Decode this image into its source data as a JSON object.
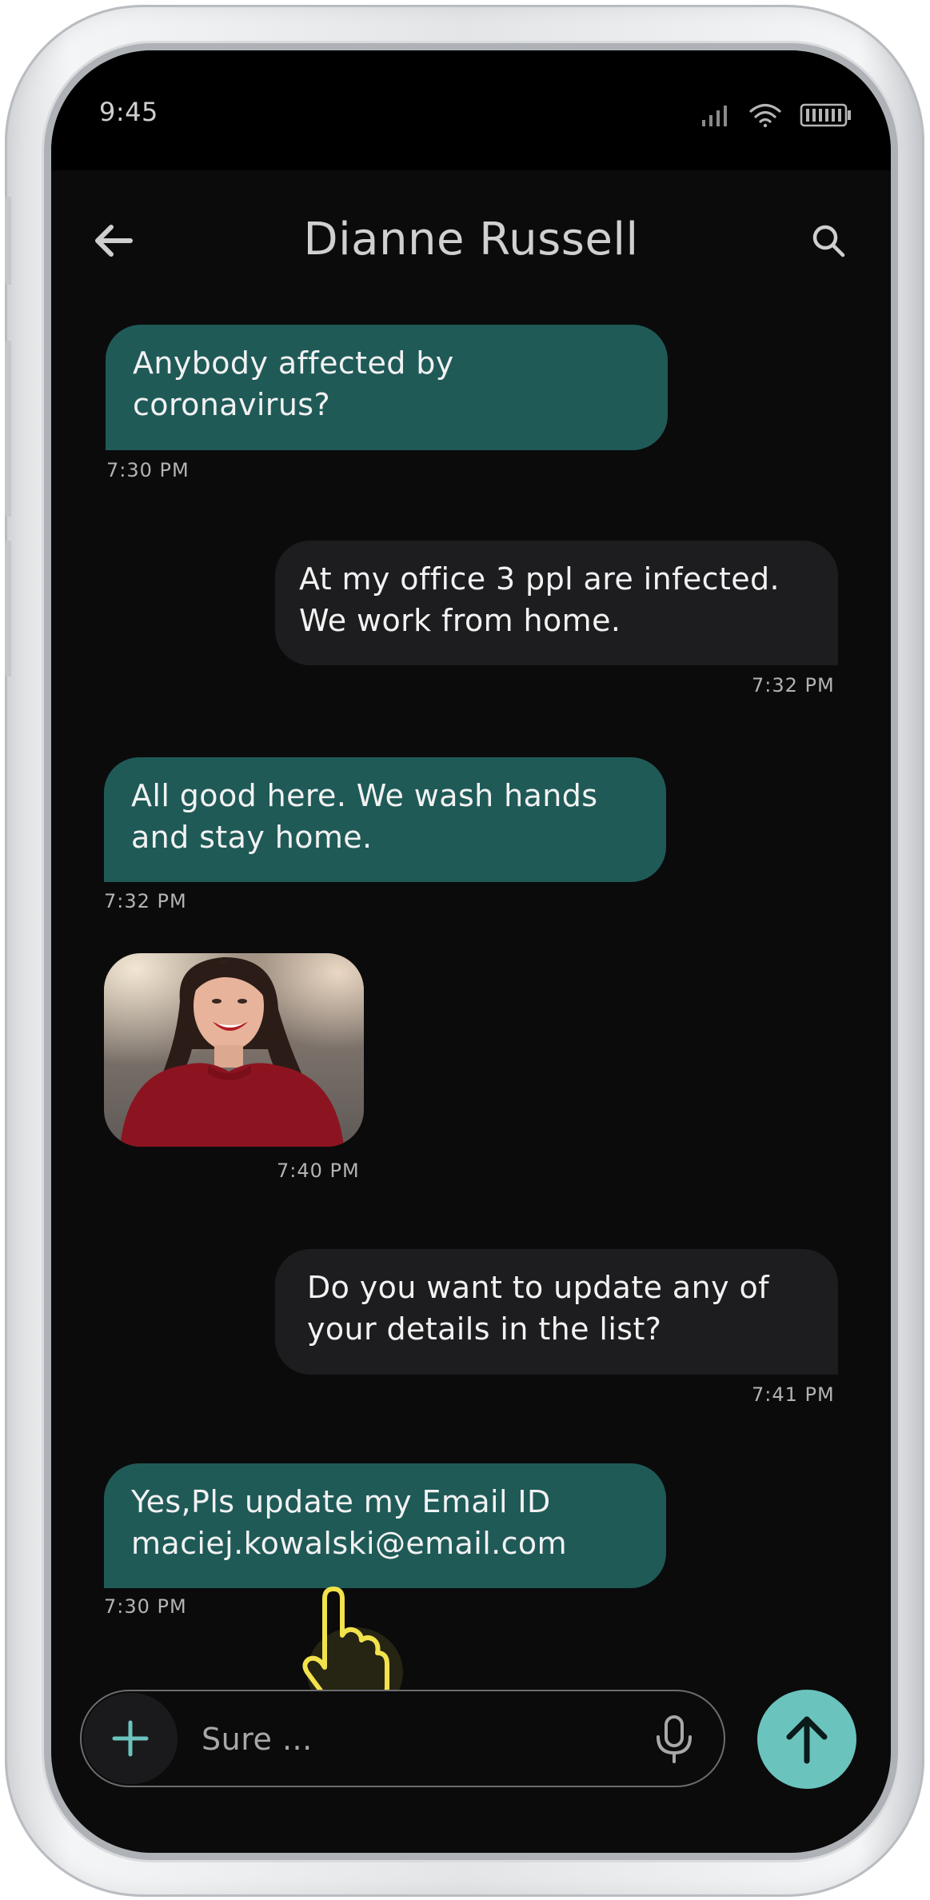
{
  "status_bar": {
    "time": "9:45",
    "icons": [
      "signal-icon",
      "wifi-icon",
      "battery-icon"
    ]
  },
  "header": {
    "title": "Dianne Russell",
    "back_icon": "arrow-left-icon",
    "search_icon": "search-icon"
  },
  "messages": [
    {
      "direction": "incoming",
      "type": "text",
      "lines": [
        "Anybody affected by",
        "coronavirus?"
      ],
      "time": "7:30 PM"
    },
    {
      "direction": "outgoing",
      "type": "text",
      "lines": [
        "At my office 3 ppl are infected.",
        "We work from home."
      ],
      "time": "7:32 PM"
    },
    {
      "direction": "incoming",
      "type": "text",
      "lines": [
        "All good here. We wash hands",
        "and stay home."
      ],
      "time": "7:32 PM"
    },
    {
      "direction": "incoming",
      "type": "image",
      "time": "7:40 PM"
    },
    {
      "direction": "outgoing",
      "type": "text",
      "lines": [
        "Do you want to update any of",
        "your details in the list?"
      ],
      "time": "7:41 PM"
    },
    {
      "direction": "incoming",
      "type": "text",
      "lines": [
        "Yes,Pls update my Email ID",
        "maciej.kowalski@email.com"
      ],
      "time": "7:30 PM"
    }
  ],
  "composer": {
    "value": "Sure ...",
    "plus_icon": "plus-icon",
    "mic_icon": "microphone-icon",
    "send_icon": "arrow-up-icon"
  },
  "colors": {
    "background": "#0b0b0c",
    "incoming_bubble": "#1f5a57",
    "outgoing_bubble": "#1d1d1f",
    "accent": "#6bc3bd",
    "pointer": "#f2e24b"
  }
}
